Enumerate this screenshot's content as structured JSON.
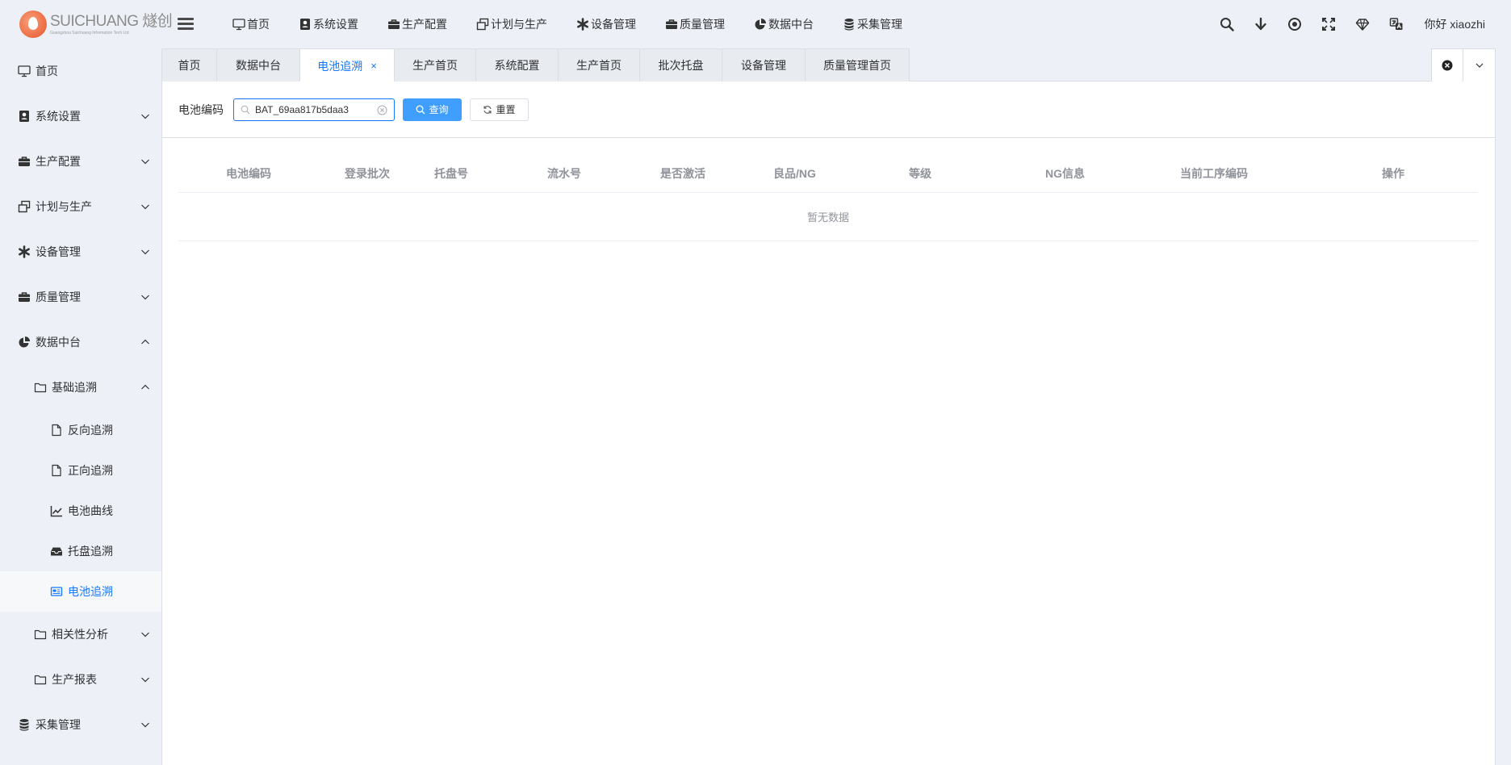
{
  "brand": {
    "name": "SUICHUANG 燧创",
    "subtitle": "Guangzhou Suichuang Information Tech Ltd"
  },
  "topnav": [
    {
      "label": "首页",
      "icon": "monitor-icon"
    },
    {
      "label": "系统设置",
      "icon": "user-card-icon"
    },
    {
      "label": "生产配置",
      "icon": "briefcase-icon"
    },
    {
      "label": "计划与生产",
      "icon": "window-restore-icon"
    },
    {
      "label": "设备管理",
      "icon": "asterisk-icon"
    },
    {
      "label": "质量管理",
      "icon": "briefcase-icon"
    },
    {
      "label": "数据中台",
      "icon": "pie-chart-icon"
    },
    {
      "label": "采集管理",
      "icon": "database-icon"
    }
  ],
  "user": {
    "greeting": "你好 xiaozhi"
  },
  "sidebar": {
    "items": [
      {
        "label": "首页"
      },
      {
        "label": "系统设置"
      },
      {
        "label": "生产配置"
      },
      {
        "label": "计划与生产"
      },
      {
        "label": "设备管理"
      },
      {
        "label": "质量管理"
      },
      {
        "label": "数据中台"
      },
      {
        "label": "基础追溯"
      },
      {
        "label": "反向追溯"
      },
      {
        "label": "正向追溯"
      },
      {
        "label": "电池曲线"
      },
      {
        "label": "托盘追溯"
      },
      {
        "label": "电池追溯"
      },
      {
        "label": "相关性分析"
      },
      {
        "label": "生产报表"
      },
      {
        "label": "采集管理"
      }
    ]
  },
  "tabs": [
    {
      "label": "首页"
    },
    {
      "label": "数据中台"
    },
    {
      "label": "电池追溯",
      "close": "×"
    },
    {
      "label": "生产首页"
    },
    {
      "label": "系统配置"
    },
    {
      "label": "生产首页"
    },
    {
      "label": "批次托盘"
    },
    {
      "label": "设备管理"
    },
    {
      "label": "质量管理首页"
    }
  ],
  "search": {
    "label": "电池编码",
    "value": "BAT_69aa817b5daa3",
    "query_button": "查询",
    "reset_button": "重置"
  },
  "table": {
    "columns": [
      "电池编码",
      "登录批次",
      "托盘号",
      "流水号",
      "是否激活",
      "良品/NG",
      "等级",
      "NG信息",
      "当前工序编码",
      "操作"
    ],
    "empty_text": "暂无数据"
  },
  "colors": {
    "accent": "#1677ff",
    "primary_button": "#409eff",
    "background": "#edf1f7"
  }
}
